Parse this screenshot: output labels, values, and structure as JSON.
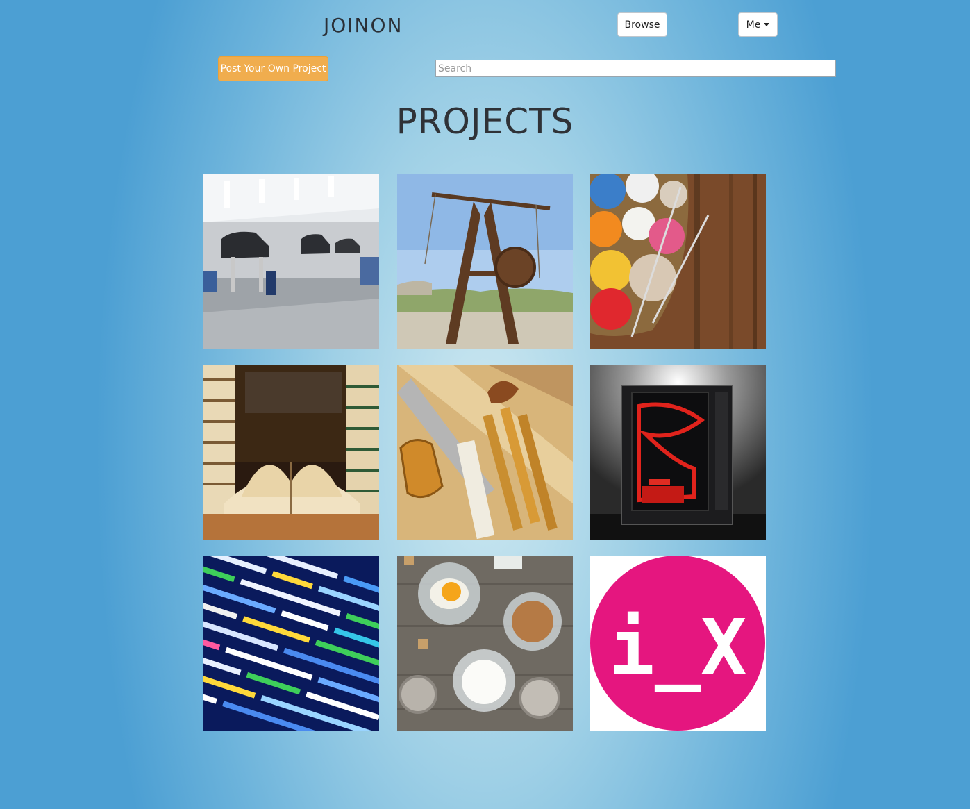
{
  "header": {
    "logo": "JOINON",
    "browse_label": "Browse",
    "me_label": "Me"
  },
  "toolbar": {
    "post_label": "Post Your Own Project",
    "search_placeholder": "Search"
  },
  "main": {
    "title": "PROJECTS",
    "projects": [
      {
        "icon": "car-garage-image"
      },
      {
        "icon": "trebuchet-image"
      },
      {
        "icon": "yarn-basket-image"
      },
      {
        "icon": "books-image"
      },
      {
        "icon": "woodworking-tools-image"
      },
      {
        "icon": "gaming-pc-image"
      },
      {
        "icon": "code-screen-image"
      },
      {
        "icon": "baking-ingredients-image"
      },
      {
        "icon": "ix-logo-image",
        "text": "i_X",
        "color": "#e5167f"
      }
    ]
  },
  "colors": {
    "accent": "#f0ad4e",
    "ix_pink": "#e5167f"
  }
}
